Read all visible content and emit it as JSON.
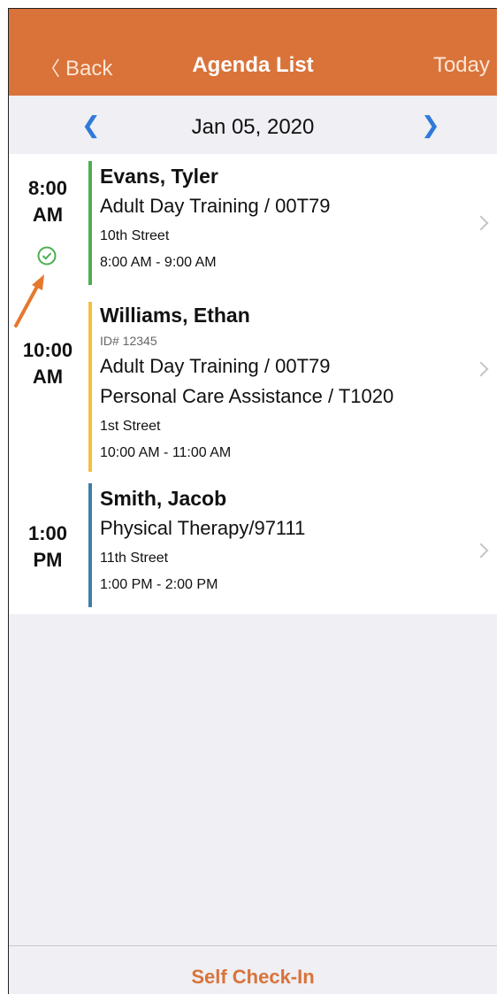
{
  "navbar": {
    "back_label": "Back",
    "title": "Agenda List",
    "today_label": "Today"
  },
  "date_bar": {
    "date": "Jan 05, 2020"
  },
  "appointments": [
    {
      "time_hour": "8:00",
      "time_ampm": "AM",
      "name": "Evans, Tyler",
      "services": [
        "Adult Day Training / 00T79"
      ],
      "street": "10th Street",
      "hours": "8:00 AM - 9:00 AM",
      "bar_color": "#4caf50",
      "checked_in": true
    },
    {
      "time_hour": "10:00",
      "time_ampm": "AM",
      "name": "Williams, Ethan",
      "id": "ID# 12345",
      "services": [
        "Adult Day Training / 00T79",
        "Personal Care Assistance / T1020"
      ],
      "street": "1st Street",
      "hours": "10:00 AM - 11:00 AM",
      "bar_color": "#f0c040"
    },
    {
      "time_hour": "1:00",
      "time_ampm": "PM",
      "name": "Smith, Jacob",
      "services": [
        "Physical Therapy/97111"
      ],
      "street": "11th Street",
      "hours": "1:00 PM - 2:00 PM",
      "bar_color": "#3f7ea7"
    }
  ],
  "footer": {
    "self_check_in_label": "Self Check-In"
  },
  "colors": {
    "accent": "#d9733a",
    "nav_arrows": "#2f7ad9",
    "check": "#4caf50"
  },
  "icons": {
    "checked_in": "check-circle-icon",
    "row_disclosure": "chevron-right-icon",
    "date_prev": "chevron-left-icon",
    "date_next": "chevron-right-icon"
  }
}
